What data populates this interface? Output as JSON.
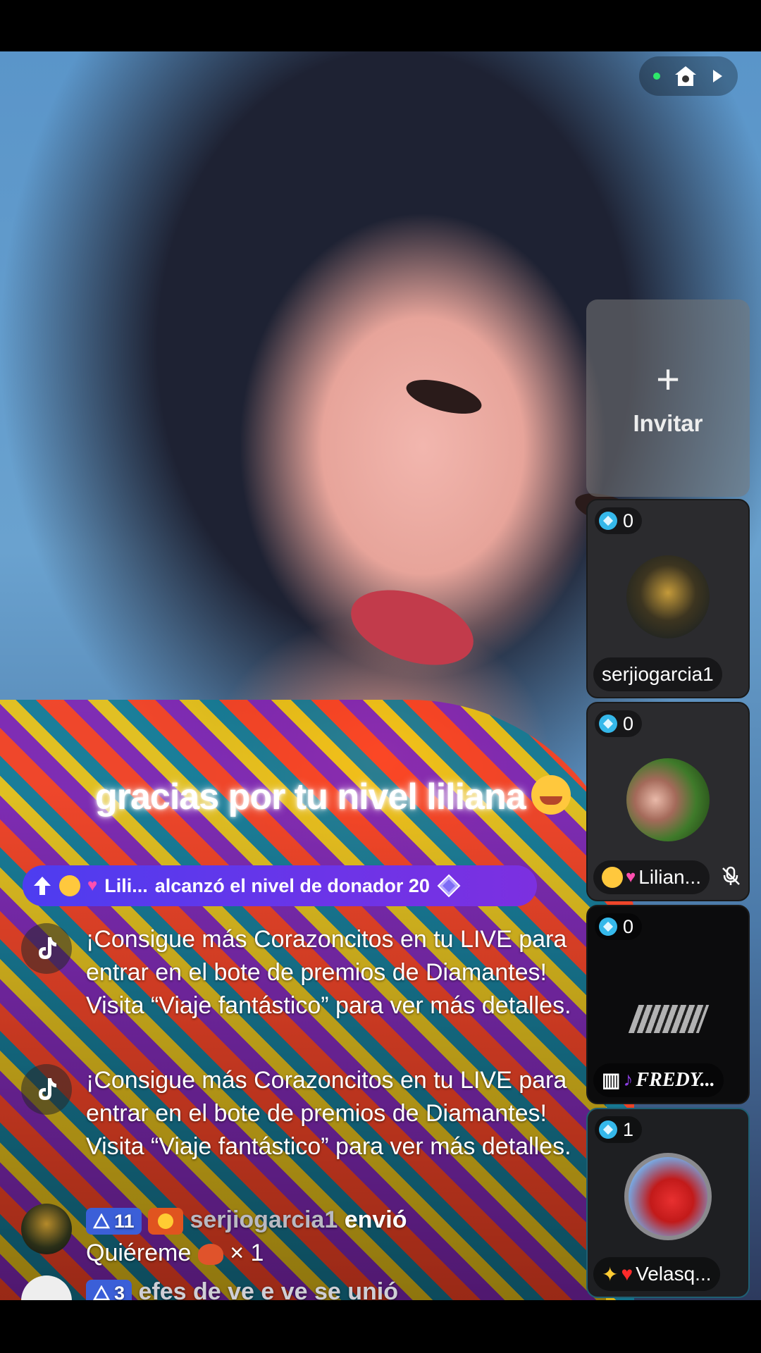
{
  "invite": {
    "plus": "+",
    "label": "Invitar"
  },
  "guests": [
    {
      "score": "0",
      "name": "serjiogarcia1"
    },
    {
      "score": "0",
      "name": "Lilian..."
    },
    {
      "score": "0",
      "name": "FREDY..."
    },
    {
      "score": "1",
      "name": "Velasq..."
    }
  ],
  "caption": "gracias por tu nivel liliana",
  "level_banner": {
    "user": "Lili...",
    "text": "alcanzó el nivel de donador 20"
  },
  "chat": [
    {
      "type": "system",
      "text": "¡Consigue más Corazoncitos en tu LIVE para entrar en el bote de premios de Diamantes! Visita “Viaje fantástico” para ver más detalles."
    },
    {
      "type": "system",
      "text": "¡Consigue más Corazoncitos en tu LIVE para entrar en el bote de premios de Diamantes! Visita “Viaje fantástico” para ver más detalles."
    },
    {
      "type": "gift",
      "level": "11",
      "user": "serjiogarcia1",
      "action": "envió",
      "gift": "Quiéreme",
      "count": "× 1"
    },
    {
      "type": "join",
      "level": "3",
      "text": "efes de ve e ve se unió"
    }
  ],
  "icons": {
    "home": "home-icon",
    "play": "play-icon",
    "tiktok": "tiktok-icon",
    "mute": "mic-mute-icon",
    "up": "level-up-icon",
    "diamond": "diamond-icon"
  },
  "colors": {
    "level_banner": "#5a3bee",
    "level_badge": "#3b5fd8",
    "live_dot": "#2ee86a",
    "score_gem": "#35b8ea"
  }
}
